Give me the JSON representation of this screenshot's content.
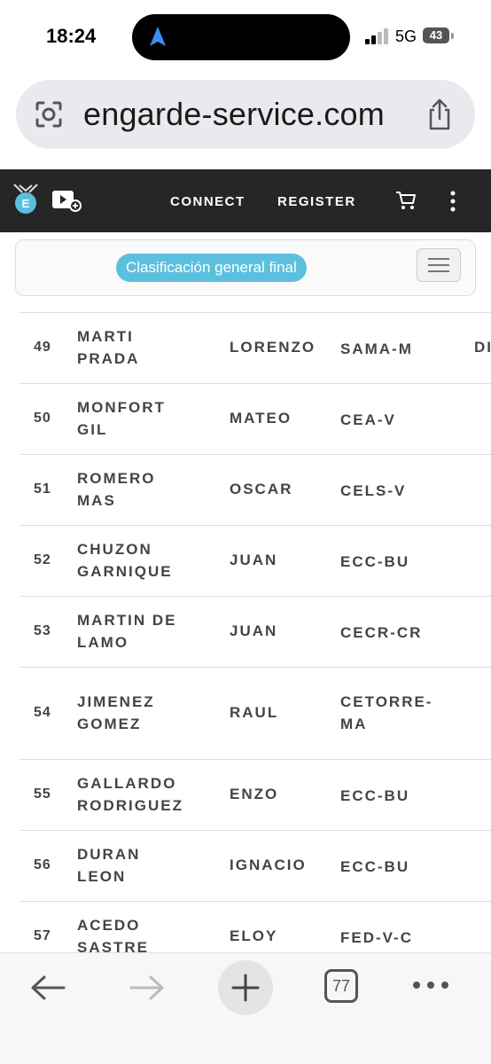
{
  "status_bar": {
    "time": "18:24",
    "network": "5G",
    "battery": "43"
  },
  "url_bar": {
    "url": "engarde-service.com"
  },
  "site_nav": {
    "links": [
      "CONNECT",
      "REGISTER"
    ]
  },
  "subheader": {
    "badge": "Clasificación general final"
  },
  "table": {
    "rows": [
      {
        "rank": "49",
        "last": "MARTI\nPRADA",
        "first": "LORENZO",
        "club": "SAMA-M",
        "extra": "DI"
      },
      {
        "rank": "50",
        "last": "MONFORT\nGIL",
        "first": "MATEO",
        "club": "CEA-V",
        "extra": ""
      },
      {
        "rank": "51",
        "last": "ROMERO\nMAS",
        "first": "OSCAR",
        "club": "CELS-V",
        "extra": ""
      },
      {
        "rank": "52",
        "last": "CHUZON\nGARNIQUE",
        "first": "JUAN",
        "club": "ECC-BU",
        "extra": ""
      },
      {
        "rank": "53",
        "last": "MARTIN DE\nLAMO",
        "first": "JUAN",
        "club": "CECR-CR",
        "extra": ""
      },
      {
        "rank": "54",
        "last": "JIMENEZ\nGOMEZ",
        "first": "RAUL",
        "club": "CETORRE-\nMA",
        "extra": ""
      },
      {
        "rank": "55",
        "last": "GALLARDO\nRODRIGUEZ",
        "first": "ENZO",
        "club": "ECC-BU",
        "extra": ""
      },
      {
        "rank": "56",
        "last": "DURAN\nLEON",
        "first": "IGNACIO",
        "club": "ECC-BU",
        "extra": ""
      },
      {
        "rank": "57",
        "last": "ACEDO\nSASTRE",
        "first": "ELOY",
        "club": "FED-V-C",
        "extra": ""
      }
    ]
  },
  "bottom_bar": {
    "tab_count": "77"
  },
  "icons": [
    "navigation-arrow-icon",
    "signal-icon",
    "lens-icon",
    "share-icon",
    "logo-icon",
    "video-add-icon",
    "cart-icon",
    "kebab-menu-icon",
    "hamburger-icon",
    "back-icon",
    "forward-icon",
    "plus-icon",
    "more-icon"
  ],
  "colors": {
    "nav_bg": "#262626",
    "badge_bg": "#5bc0de",
    "url_bar_bg": "#e8eaed"
  }
}
